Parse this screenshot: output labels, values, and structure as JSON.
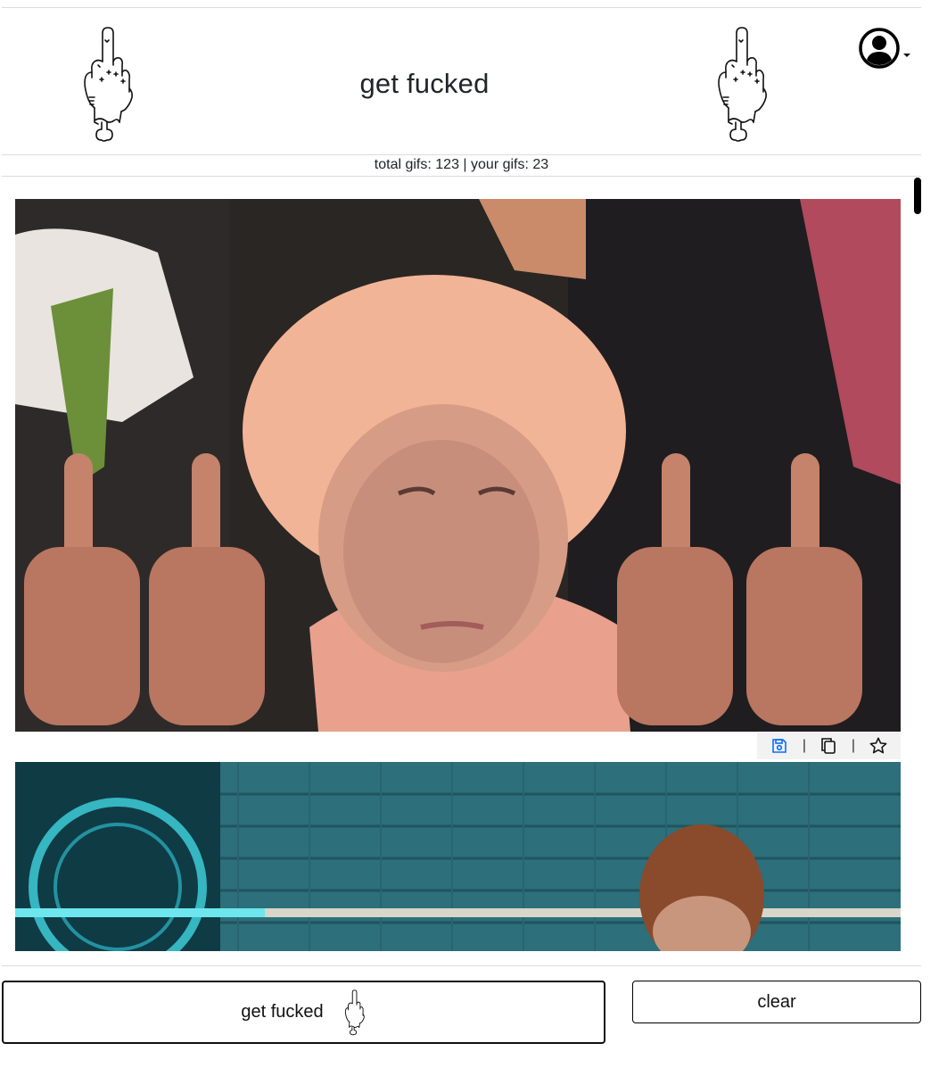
{
  "header": {
    "title": "get fucked"
  },
  "stats": {
    "total_label": "total gifs:",
    "total_count": "123",
    "separator": "|",
    "yours_label": "your gifs:",
    "yours_count": "23"
  },
  "gif_actions": {
    "separator": "|",
    "icons": [
      "save-icon",
      "copy-icon",
      "favorite-star-icon"
    ],
    "accent": "#0d6efd"
  },
  "footer": {
    "primary_label": "get fucked",
    "clear_label": "clear"
  },
  "colors": {
    "border": "#000000",
    "rule": "#dcdcdc",
    "text": "#212529"
  }
}
